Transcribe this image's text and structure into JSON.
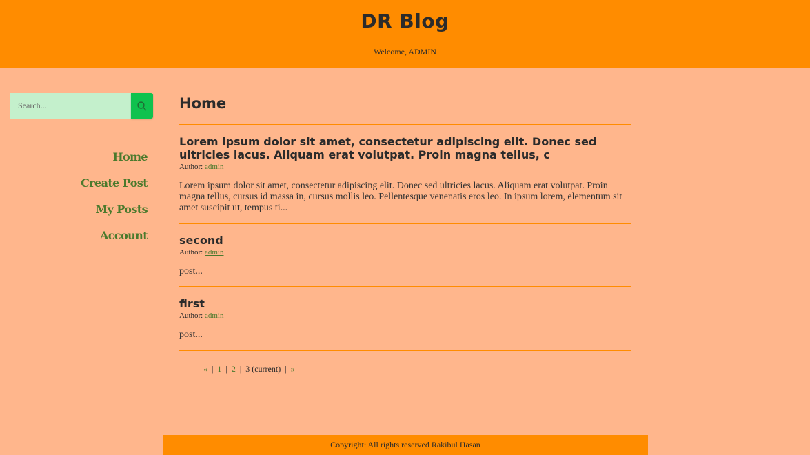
{
  "header": {
    "site_title": "DR Blog",
    "welcome": "Welcome, ADMIN"
  },
  "search": {
    "placeholder": "Search...",
    "icon": "search-icon"
  },
  "nav": {
    "items": [
      {
        "label": "Home"
      },
      {
        "label": "Create Post"
      },
      {
        "label": "My Posts"
      },
      {
        "label": "Account"
      }
    ]
  },
  "main": {
    "page_title": "Home",
    "posts": [
      {
        "title": "Lorem ipsum dolor sit amet, consectetur adipiscing elit. Donec sed ultricies lacus. Aliquam erat volutpat. Proin magna tellus, c",
        "author_label": "Author:",
        "author": "admin",
        "excerpt": "Lorem ipsum dolor sit amet, consectetur adipiscing elit. Donec sed ultricies lacus. Aliquam erat volutpat. Proin magna tellus, cursus id massa in, cursus mollis leo. Pellentesque venenatis eros leo. In ipsum lorem, elementum sit amet suscipit ut, tempus ti..."
      },
      {
        "title": "second",
        "author_label": "Author:",
        "author": "admin",
        "excerpt": "post..."
      },
      {
        "title": "first",
        "author_label": "Author:",
        "author": "admin",
        "excerpt": "post..."
      }
    ]
  },
  "pagination": {
    "prev": "«",
    "sep": "|",
    "page1": "1",
    "page2": "2",
    "current": "3 (current)",
    "next": "»"
  },
  "footer": {
    "copyright": "Copyright: All rights reserved Rakibul Hasan"
  },
  "colors": {
    "header_bg": "#ff8c00",
    "page_bg": "#ffb68c",
    "link_green": "#4b7a2d",
    "search_btn": "#0fc24e",
    "search_bg": "#c4f0cc"
  }
}
